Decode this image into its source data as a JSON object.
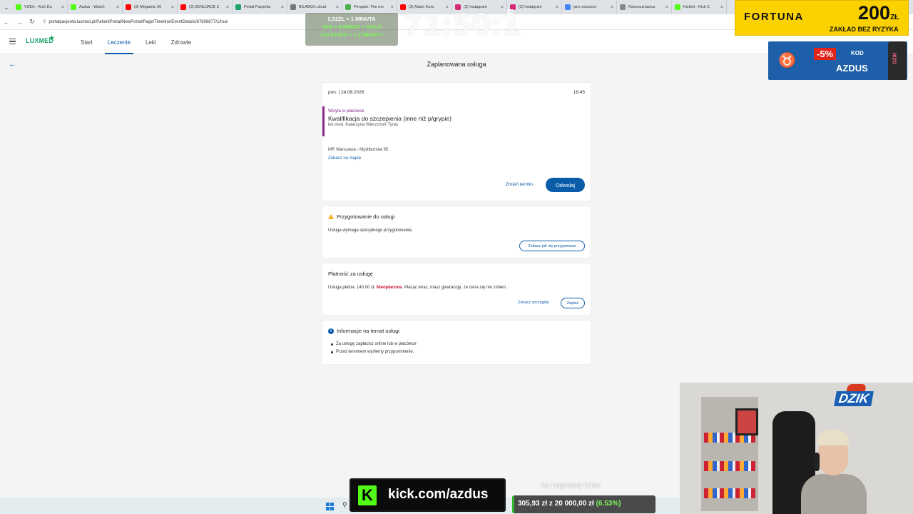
{
  "browser": {
    "tabs": [
      {
        "label": "VODs - Kick Da",
        "color": "#53fc18"
      },
      {
        "label": "Azdus - Watch",
        "color": "#53fc18"
      },
      {
        "label": "(3) Megamix 20",
        "color": "#ff0000"
      },
      {
        "label": "(3) ZENUJĄCE Z",
        "color": "#ff0000"
      },
      {
        "label": "Portal Pacjenta",
        "color": "#1fa36a"
      },
      {
        "label": "BILABOX.cloud",
        "color": "#777777"
      },
      {
        "label": "Penguin: The mo",
        "color": "#4caf50"
      },
      {
        "label": "(3) Adam Kuro",
        "color": "#ff0000"
      },
      {
        "label": "(2) Instagram",
        "color": "#d62976"
      },
      {
        "label": "(2) Instagram",
        "color": "#d62976"
      },
      {
        "label": "jam rzeczozn",
        "color": "#4285f4"
      },
      {
        "label": "Rzeczoznawca",
        "color": "#888888"
      },
      {
        "label": "Kicklet - Kick C",
        "color": "#53fc18"
      }
    ],
    "url": "portalpacjenta.luxmed.pl/PatientPortal/NewPortal/Page/Timeline/EventDetails/67608877/1/true"
  },
  "app": {
    "logo": "LUXMED",
    "nav": [
      "Start",
      "Leczenie",
      "Leki",
      "Zdrowie"
    ],
    "active_nav": "Leczenie"
  },
  "page": {
    "title": "Zaplanowana usługa",
    "appointment": {
      "date": "pon. | 24.08.2026",
      "time": "18:45",
      "visit_type": "Wizyta w placówce",
      "service": "Kwalifikacja do szczepienia (inne niż p/grypie)",
      "doctor": "lek.med. Katarzyna Wierzchoń-Tyras",
      "address": "MR Warszawa - Myśliborska 95",
      "map_link": "Zobacz na mapie",
      "change_label": "Zmień termin",
      "cancel_label": "Odwołaj"
    },
    "preparation": {
      "title": "Przygotowanie do usługi",
      "text": "Usługa wymaga specjalnego przygotowania.",
      "button": "Zobacz jak się przygotować"
    },
    "payment": {
      "title": "Płatność za usługę",
      "text_before": "Usługa płatna: 140.00 zł.",
      "status": "Nieopłacona",
      "text_after": ". Płacąc teraz, masz gwarancję, że cena się nie zmieni.",
      "details_link": "Zobacz szczegóły",
      "pay_button": "Zapłać"
    },
    "info": {
      "title": "Informacje na temat usługi",
      "items": [
        "Za usługę zapłacisz online lub w placówce",
        "Przed terminem wyślemy przypomnienie."
      ]
    }
  },
  "overlays": {
    "timer": "71:50:1",
    "timer_sup": "5",
    "promo_lines": [
      "2,52ZŁ = 1 MINUTA",
      "5SB = 8 MINUT + KOŁO",
      "100 KICKS = 1.2 MINUTY"
    ],
    "fortuna": {
      "brand": "FORTUNA",
      "amount": "200",
      "currency": "ZŁ",
      "sub": "ZAKŁAD BEZ RYZYKA"
    },
    "dzik_ad": {
      "discount": "-5%",
      "kod_label": "KOD",
      "code": "AZDUS",
      "can_text": "DZIK"
    },
    "dzik_logo": "DZIK",
    "kick": {
      "k": "K",
      "text": "kick.com/azdus"
    },
    "goal": {
      "label": "na naprawę bmw",
      "current": "305,93 zł",
      "target": "20 000,00 zł",
      "percent_text": "(6.53%)",
      "fraction": 0.0153
    }
  }
}
